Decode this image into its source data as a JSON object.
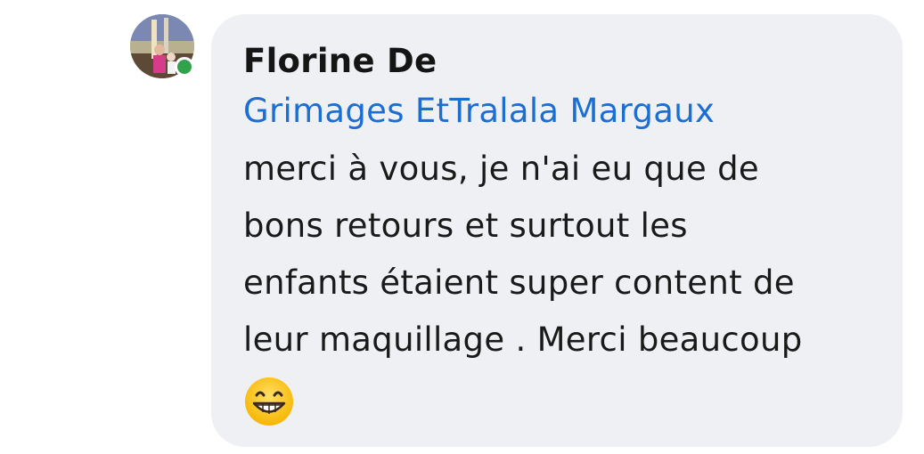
{
  "comment": {
    "author": "Florine De",
    "mention": "Grimages EtTralala Margaux",
    "message_lines": [
      "merci à vous, je n'ai eu que de",
      "bons retours et surtout les",
      "enfants étaient super content de",
      "leur maquillage . Merci beaucoup"
    ],
    "emoji": "grinning-face-with-smiling-eyes",
    "online": true
  },
  "colors": {
    "bubble_bg": "#eff0f4",
    "mention": "#1c6fd0",
    "online_dot": "#31a24c",
    "text": "#1a1a1a"
  }
}
